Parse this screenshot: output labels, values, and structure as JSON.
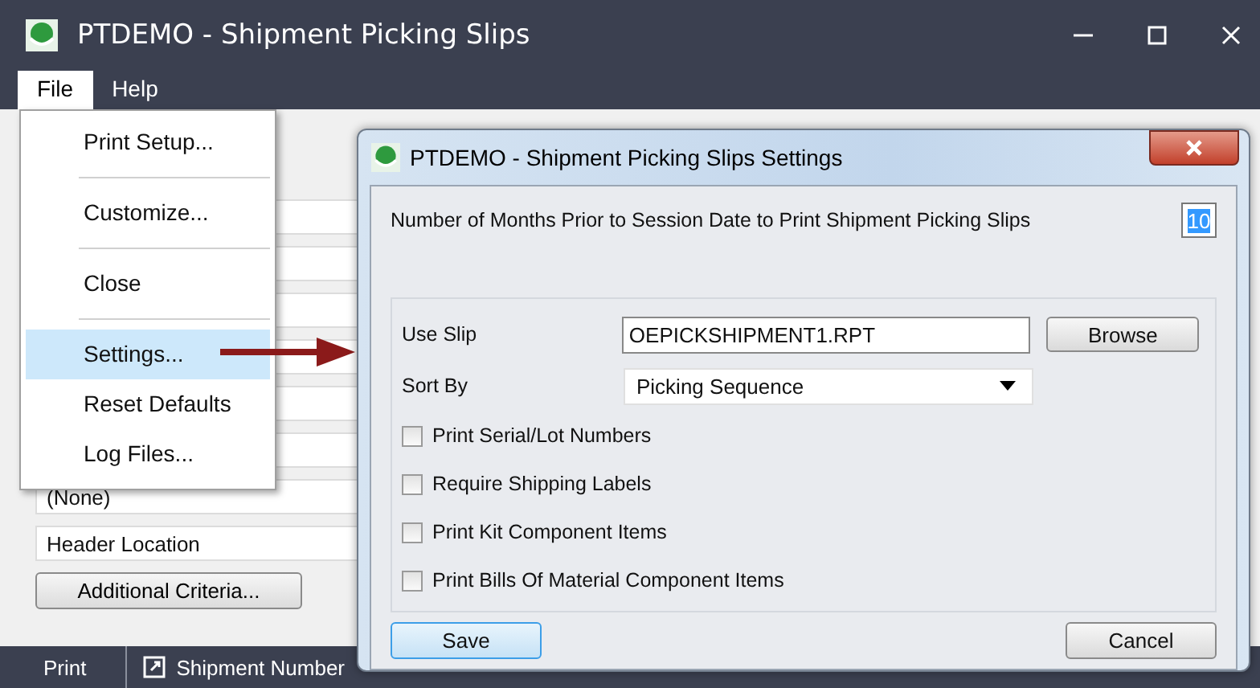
{
  "window": {
    "title": "PTDEMO - Shipment Picking Slips"
  },
  "menu_bar": [
    {
      "label": "File",
      "selected": true
    },
    {
      "label": "Help",
      "selected": false
    }
  ],
  "file_menu": [
    {
      "kind": "item",
      "label": "Print Setup...",
      "selected": false
    },
    {
      "kind": "separator"
    },
    {
      "kind": "item",
      "label": "Customize...",
      "selected": false
    },
    {
      "kind": "separator"
    },
    {
      "kind": "item",
      "label": "Close",
      "selected": false
    },
    {
      "kind": "separator"
    },
    {
      "kind": "item",
      "label": "Settings...",
      "selected": true
    },
    {
      "kind": "item",
      "label": "Reset Defaults",
      "selected": false
    },
    {
      "kind": "item",
      "label": "Log Files...",
      "selected": false
    }
  ],
  "form": {
    "fields": [
      {
        "kind": "blank"
      },
      {
        "kind": "blank"
      },
      {
        "kind": "blank"
      },
      {
        "kind": "blank"
      },
      {
        "kind": "blank"
      },
      {
        "kind": "blank"
      },
      {
        "kind": "text",
        "value": "(None)"
      },
      {
        "kind": "text",
        "value": "Header Location"
      }
    ],
    "button": "Additional Criteria..."
  },
  "grid": {
    "columns": [
      "Print",
      "Shipment Number"
    ]
  },
  "dialog": {
    "title": "PTDEMO - Shipment Picking Slips Settings",
    "months_label": "Number of Months Prior to Session Date to Print Shipment Picking Slips",
    "months_value": "10",
    "use_slip_label": "Use Slip",
    "use_slip_value": "OEPICKSHIPMENT1.RPT",
    "browse_button": "Browse",
    "sort_by_label": "Sort By",
    "sort_by_value": "Picking Sequence",
    "options": [
      {
        "label": "Print Serial/Lot Numbers",
        "checked": false
      },
      {
        "label": "Require Shipping Labels",
        "checked": false
      },
      {
        "label": "Print Kit Component Items",
        "checked": false
      },
      {
        "label": "Print Bills Of Material Component Items",
        "checked": false
      }
    ],
    "save_button": "Save",
    "cancel_button": "Cancel"
  }
}
